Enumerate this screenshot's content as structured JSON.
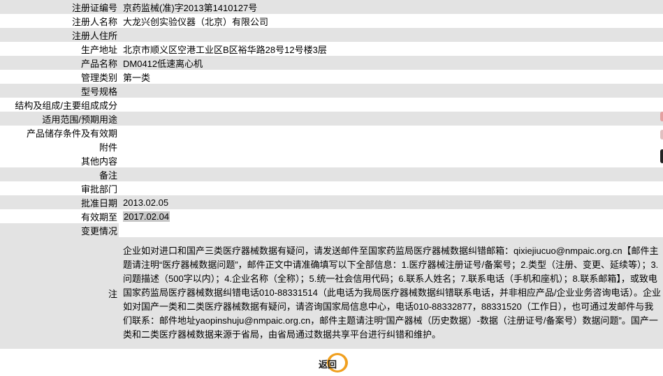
{
  "rows": [
    {
      "label": "注册证编号",
      "value": "京药监械(准)字2013第1410127号"
    },
    {
      "label": "注册人名称",
      "value": "大龙兴创实验仪器（北京）有限公司"
    },
    {
      "label": "注册人住所",
      "value": ""
    },
    {
      "label": "生产地址",
      "value": "北京市顺义区空港工业区B区裕华路28号12号楼3层"
    },
    {
      "label": "产品名称",
      "value": "DM0412低速离心机"
    },
    {
      "label": "管理类别",
      "value": "第一类"
    },
    {
      "label": "型号规格",
      "value": ""
    },
    {
      "label": "结构及组成/主要组成成分",
      "value": ""
    },
    {
      "label": "适用范围/预期用途",
      "value": ""
    },
    {
      "label": "产品储存条件及有效期",
      "value": ""
    },
    {
      "label": "附件",
      "value": ""
    },
    {
      "label": "其他内容",
      "value": ""
    },
    {
      "label": "备注",
      "value": ""
    },
    {
      "label": "审批部门",
      "value": ""
    },
    {
      "label": "批准日期",
      "value": "2013.02.05"
    },
    {
      "label": "有效期至",
      "value": "2017.02.04"
    }
  ],
  "change_label": "变更情况",
  "note": {
    "label": "注",
    "text": "企业如对进口和国产三类医疗器械数据有疑问，请发送邮件至国家药监局医疗器械数据纠错邮箱：qixiejiucuo@nmpaic.org.cn【邮件主题请注明“医疗器械数据问题”，邮件正文中请准确填写以下全部信息：1.医疗器械注册证号/备案号；2.类型（注册、变更、延续等）；3.问题描述（500字以内）；4.企业名称（全称）；5.统一社会信用代码；6.联系人姓名；7.联系电话（手机和座机）；8.联系邮箱】，或致电国家药监局医疗器械数据纠错电话010-88331514（此电话为我局医疗器械数据纠错联系电话，并非相应产品/企业业务咨询电话）。企业如对国产一类和二类医疗器械数据有疑问，请咨询国家局信息中心，电话010-88332877，88331520（工作日），也可通过发邮件与我们联系：邮件地址yaopinshuju@nmpaic.org.cn，邮件主题请注明“国产器械（历史数据）-数据（注册证号/备案号）数据问题”。国产一类和二类医疗器械数据来源于省局，由省局通过数据共享平台进行纠错和维护。"
  },
  "back_button": {
    "label": "返回",
    "accent": "#f0a020"
  },
  "colors": {
    "row_gray": "#e3e3e3",
    "row_white": "#ffffff",
    "highlight": "#c8c8c8"
  }
}
